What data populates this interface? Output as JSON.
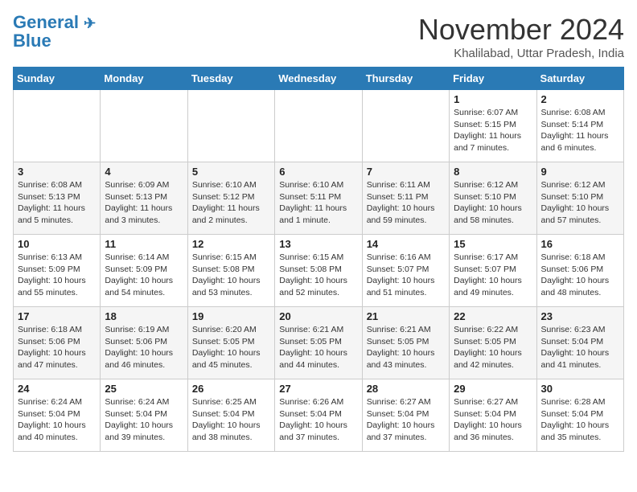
{
  "header": {
    "logo_line1": "General",
    "logo_line2": "Blue",
    "month": "November 2024",
    "location": "Khalilabad, Uttar Pradesh, India"
  },
  "weekdays": [
    "Sunday",
    "Monday",
    "Tuesday",
    "Wednesday",
    "Thursday",
    "Friday",
    "Saturday"
  ],
  "weeks": [
    [
      {
        "day": "",
        "info": ""
      },
      {
        "day": "",
        "info": ""
      },
      {
        "day": "",
        "info": ""
      },
      {
        "day": "",
        "info": ""
      },
      {
        "day": "",
        "info": ""
      },
      {
        "day": "1",
        "info": "Sunrise: 6:07 AM\nSunset: 5:15 PM\nDaylight: 11 hours and 7 minutes."
      },
      {
        "day": "2",
        "info": "Sunrise: 6:08 AM\nSunset: 5:14 PM\nDaylight: 11 hours and 6 minutes."
      }
    ],
    [
      {
        "day": "3",
        "info": "Sunrise: 6:08 AM\nSunset: 5:13 PM\nDaylight: 11 hours and 5 minutes."
      },
      {
        "day": "4",
        "info": "Sunrise: 6:09 AM\nSunset: 5:13 PM\nDaylight: 11 hours and 3 minutes."
      },
      {
        "day": "5",
        "info": "Sunrise: 6:10 AM\nSunset: 5:12 PM\nDaylight: 11 hours and 2 minutes."
      },
      {
        "day": "6",
        "info": "Sunrise: 6:10 AM\nSunset: 5:11 PM\nDaylight: 11 hours and 1 minute."
      },
      {
        "day": "7",
        "info": "Sunrise: 6:11 AM\nSunset: 5:11 PM\nDaylight: 10 hours and 59 minutes."
      },
      {
        "day": "8",
        "info": "Sunrise: 6:12 AM\nSunset: 5:10 PM\nDaylight: 10 hours and 58 minutes."
      },
      {
        "day": "9",
        "info": "Sunrise: 6:12 AM\nSunset: 5:10 PM\nDaylight: 10 hours and 57 minutes."
      }
    ],
    [
      {
        "day": "10",
        "info": "Sunrise: 6:13 AM\nSunset: 5:09 PM\nDaylight: 10 hours and 55 minutes."
      },
      {
        "day": "11",
        "info": "Sunrise: 6:14 AM\nSunset: 5:09 PM\nDaylight: 10 hours and 54 minutes."
      },
      {
        "day": "12",
        "info": "Sunrise: 6:15 AM\nSunset: 5:08 PM\nDaylight: 10 hours and 53 minutes."
      },
      {
        "day": "13",
        "info": "Sunrise: 6:15 AM\nSunset: 5:08 PM\nDaylight: 10 hours and 52 minutes."
      },
      {
        "day": "14",
        "info": "Sunrise: 6:16 AM\nSunset: 5:07 PM\nDaylight: 10 hours and 51 minutes."
      },
      {
        "day": "15",
        "info": "Sunrise: 6:17 AM\nSunset: 5:07 PM\nDaylight: 10 hours and 49 minutes."
      },
      {
        "day": "16",
        "info": "Sunrise: 6:18 AM\nSunset: 5:06 PM\nDaylight: 10 hours and 48 minutes."
      }
    ],
    [
      {
        "day": "17",
        "info": "Sunrise: 6:18 AM\nSunset: 5:06 PM\nDaylight: 10 hours and 47 minutes."
      },
      {
        "day": "18",
        "info": "Sunrise: 6:19 AM\nSunset: 5:06 PM\nDaylight: 10 hours and 46 minutes."
      },
      {
        "day": "19",
        "info": "Sunrise: 6:20 AM\nSunset: 5:05 PM\nDaylight: 10 hours and 45 minutes."
      },
      {
        "day": "20",
        "info": "Sunrise: 6:21 AM\nSunset: 5:05 PM\nDaylight: 10 hours and 44 minutes."
      },
      {
        "day": "21",
        "info": "Sunrise: 6:21 AM\nSunset: 5:05 PM\nDaylight: 10 hours and 43 minutes."
      },
      {
        "day": "22",
        "info": "Sunrise: 6:22 AM\nSunset: 5:05 PM\nDaylight: 10 hours and 42 minutes."
      },
      {
        "day": "23",
        "info": "Sunrise: 6:23 AM\nSunset: 5:04 PM\nDaylight: 10 hours and 41 minutes."
      }
    ],
    [
      {
        "day": "24",
        "info": "Sunrise: 6:24 AM\nSunset: 5:04 PM\nDaylight: 10 hours and 40 minutes."
      },
      {
        "day": "25",
        "info": "Sunrise: 6:24 AM\nSunset: 5:04 PM\nDaylight: 10 hours and 39 minutes."
      },
      {
        "day": "26",
        "info": "Sunrise: 6:25 AM\nSunset: 5:04 PM\nDaylight: 10 hours and 38 minutes."
      },
      {
        "day": "27",
        "info": "Sunrise: 6:26 AM\nSunset: 5:04 PM\nDaylight: 10 hours and 37 minutes."
      },
      {
        "day": "28",
        "info": "Sunrise: 6:27 AM\nSunset: 5:04 PM\nDaylight: 10 hours and 37 minutes."
      },
      {
        "day": "29",
        "info": "Sunrise: 6:27 AM\nSunset: 5:04 PM\nDaylight: 10 hours and 36 minutes."
      },
      {
        "day": "30",
        "info": "Sunrise: 6:28 AM\nSunset: 5:04 PM\nDaylight: 10 hours and 35 minutes."
      }
    ]
  ]
}
